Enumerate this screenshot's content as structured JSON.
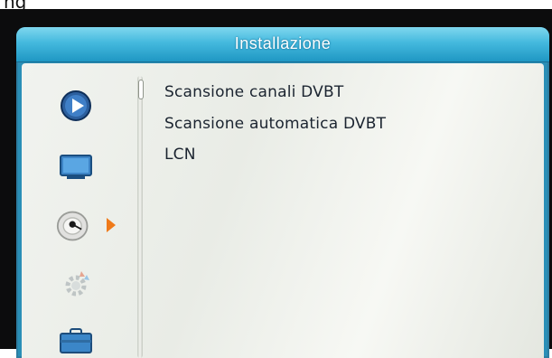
{
  "header": {
    "title": "Installazione"
  },
  "top_fragment": "ng",
  "sidebar": {
    "items": [
      {
        "icon": "play-icon"
      },
      {
        "icon": "monitor-icon"
      },
      {
        "icon": "satellite-dish-icon",
        "selected": true
      },
      {
        "icon": "gear-icon"
      },
      {
        "icon": "briefcase-icon"
      }
    ]
  },
  "menu": {
    "items": [
      {
        "label": "Scansione canali DVBT"
      },
      {
        "label": "Scansione automatica DVBT"
      },
      {
        "label": "LCN"
      }
    ]
  },
  "colors": {
    "title_bar": "#44b9de",
    "selection_arrow": "#ef7a1a",
    "text": "#1b2430"
  }
}
